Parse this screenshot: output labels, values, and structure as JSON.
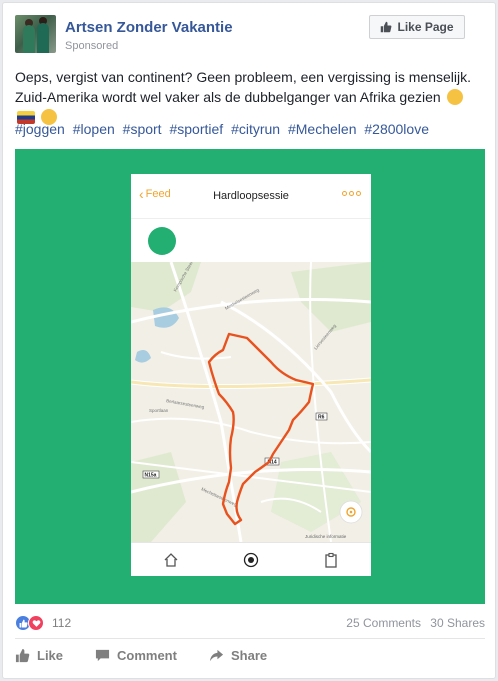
{
  "post": {
    "page_name": "Artsen Zonder Vakantie",
    "sponsored": "Sponsored",
    "like_page_label": "Like Page",
    "text": "Oeps, vergist van continent? Geen probleem, een vergissing is menselijk. Zuid-Amerika wordt wel vaker als de dubbelganger van Afrika gezien",
    "emojis": [
      "thinking-face-emoji",
      "venezuela-flag-emoji",
      "grinning-face-emoji"
    ],
    "hashtags": [
      "#joggen",
      "#lopen",
      "#sport",
      "#sportief",
      "#cityrun",
      "#Mechelen",
      "#2800love"
    ]
  },
  "media": {
    "background_color": "#23ae72",
    "phone": {
      "back_label": "Feed",
      "title": "Hardloopsessie",
      "accent_color": "#f1a42e",
      "route_color": "#e8521f",
      "map_labels": {
        "road_1": "Mechelsesteenweg",
        "road_2": "Mechelsesteenweg",
        "road_3": "Berlaarsesteenweg",
        "road_4": "Kempische Steenweg",
        "road_5": "Liersesteenweg",
        "road_6": "Sportlaan",
        "route_n14": "N14",
        "route_n15a": "N15a",
        "route_r6": "R6",
        "legal": "Juridische informatie"
      }
    }
  },
  "stats": {
    "reaction_count": "112",
    "comments": "25 Comments",
    "shares": "30 Shares"
  },
  "actions": {
    "like": "Like",
    "comment": "Comment",
    "share": "Share"
  }
}
